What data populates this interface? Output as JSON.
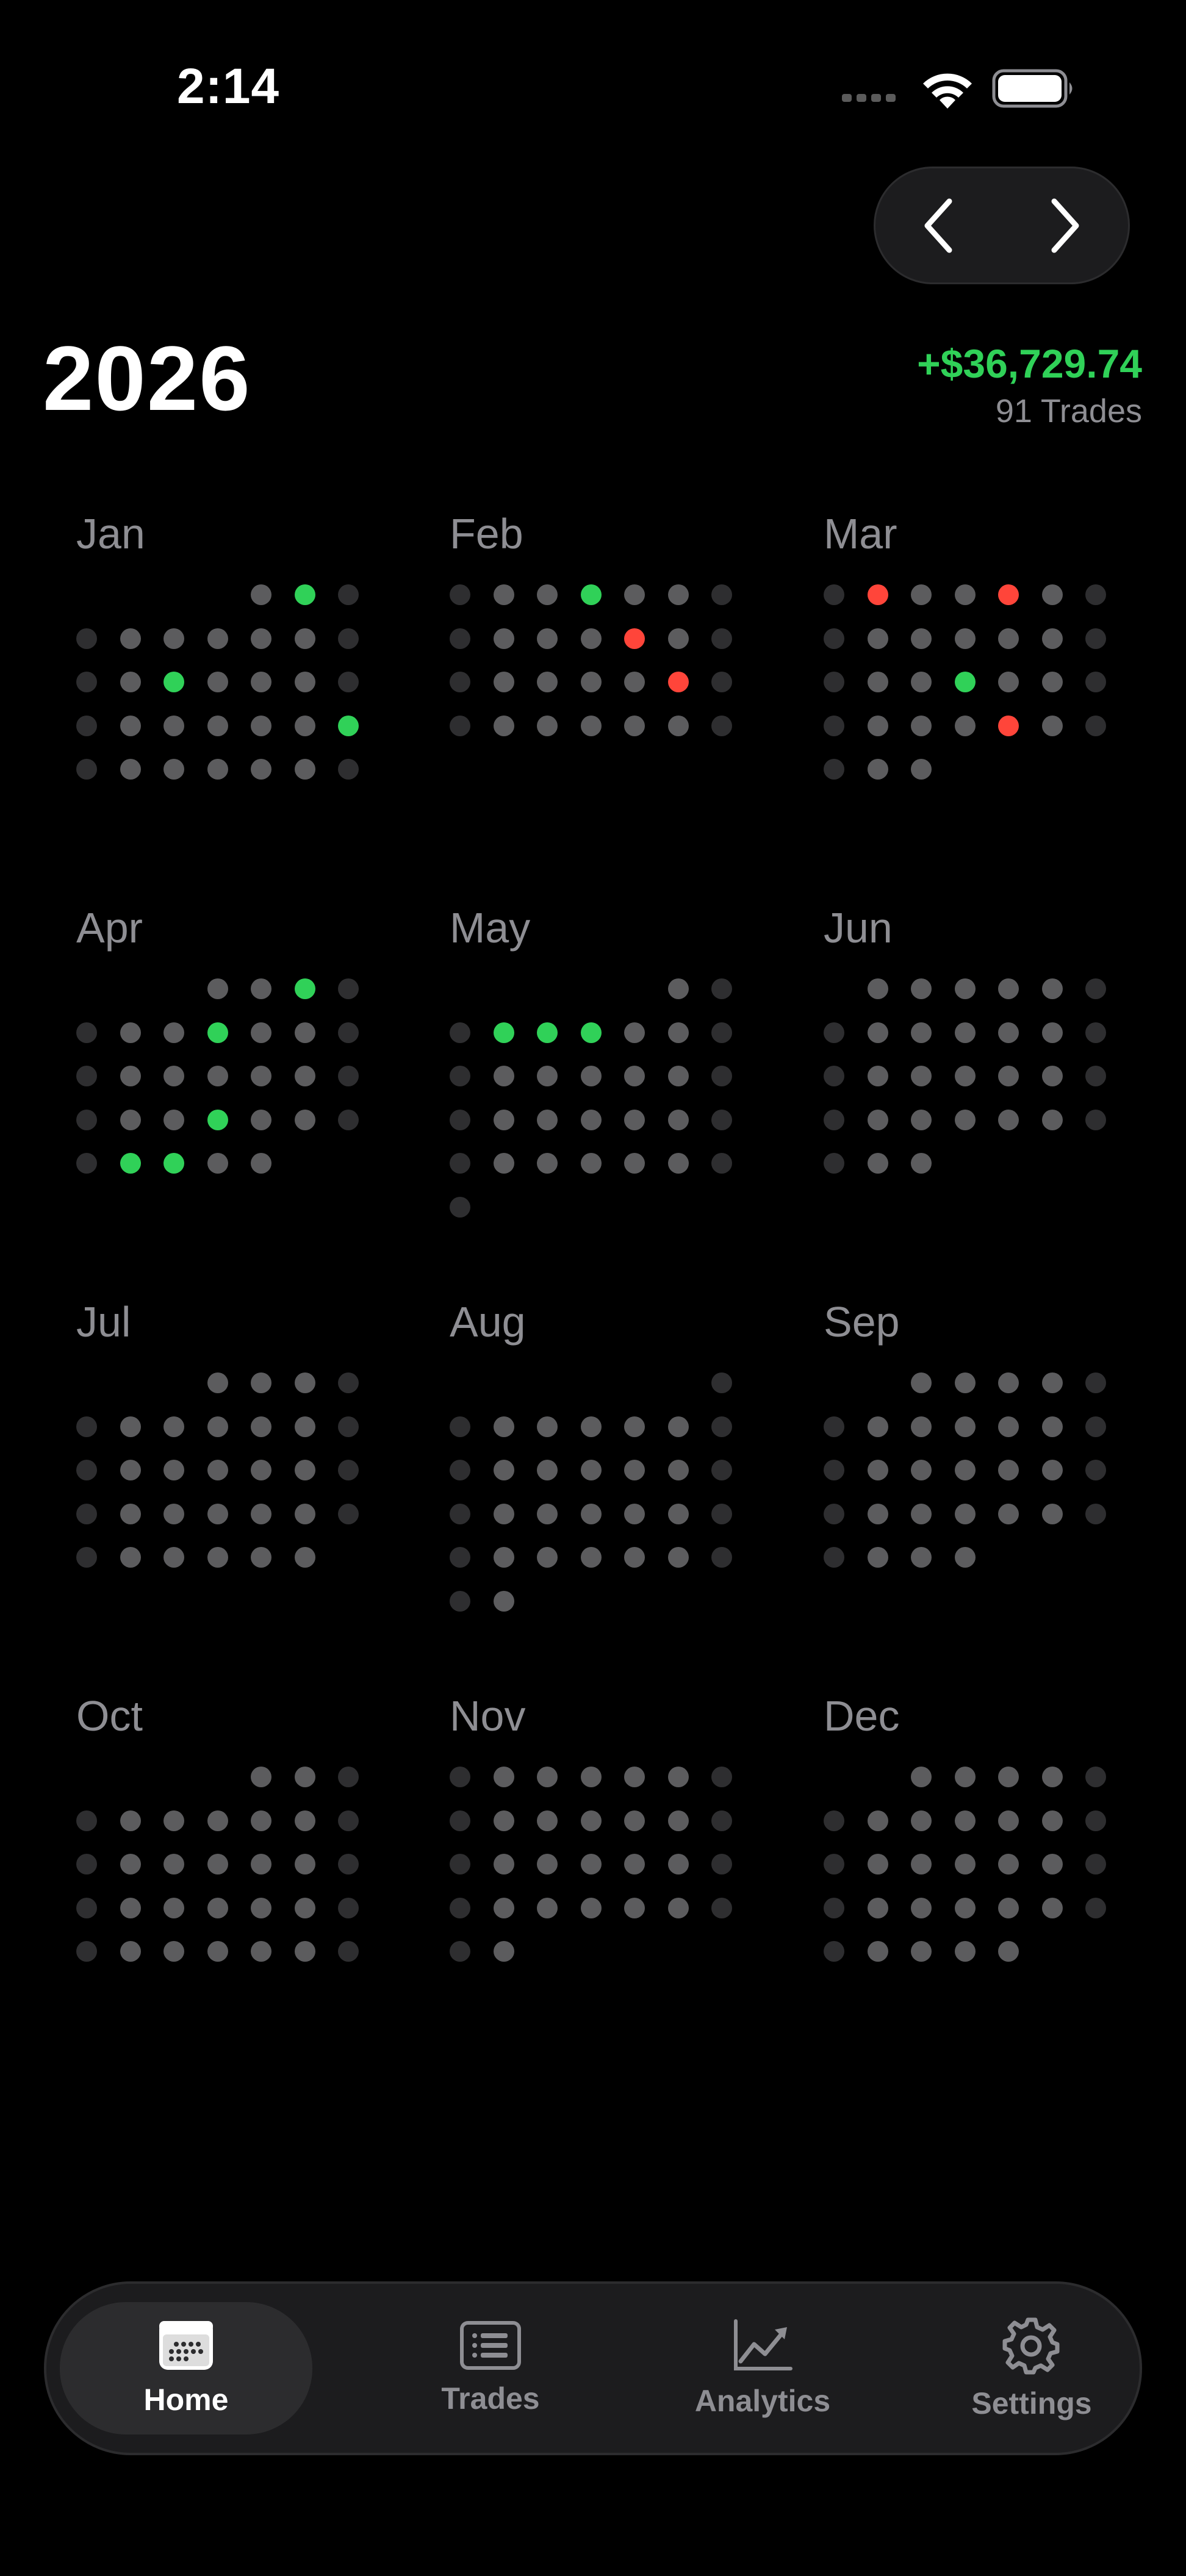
{
  "status_bar": {
    "time": "2:14",
    "icons": [
      "signal-dots-icon",
      "wifi-icon",
      "battery-icon"
    ]
  },
  "nav": {
    "prev_icon": "chevron-left-icon",
    "next_icon": "chevron-right-icon"
  },
  "header": {
    "year": "2026",
    "total_pnl": "+$36,729.74",
    "trade_count": "91 Trades"
  },
  "colors": {
    "background": "#000000",
    "win": "#30d158",
    "loss": "#ff453a",
    "trading_day": "#5c5c5e",
    "weekend_day": "#2e2e30",
    "muted_text": "#8e8e93"
  },
  "calendar": {
    "weekday_order": [
      "Sun",
      "Mon",
      "Tue",
      "Wed",
      "Thu",
      "Fri",
      "Sat"
    ],
    "months": [
      {
        "name": "Jan",
        "first_weekday": 4,
        "days": 31,
        "wins": [
          2,
          13,
          24
        ],
        "losses": []
      },
      {
        "name": "Feb",
        "first_weekday": 0,
        "days": 28,
        "wins": [
          4
        ],
        "losses": [
          12,
          20
        ]
      },
      {
        "name": "Mar",
        "first_weekday": 0,
        "days": 31,
        "wins": [
          18
        ],
        "losses": [
          2,
          5,
          26
        ]
      },
      {
        "name": "Apr",
        "first_weekday": 3,
        "days": 30,
        "wins": [
          3,
          8,
          22,
          27,
          28
        ],
        "losses": []
      },
      {
        "name": "May",
        "first_weekday": 5,
        "days": 31,
        "wins": [
          4,
          5,
          6
        ],
        "losses": []
      },
      {
        "name": "Jun",
        "first_weekday": 1,
        "days": 30,
        "wins": [],
        "losses": []
      },
      {
        "name": "Jul",
        "first_weekday": 3,
        "days": 31,
        "wins": [],
        "losses": []
      },
      {
        "name": "Aug",
        "first_weekday": 6,
        "days": 31,
        "wins": [],
        "losses": []
      },
      {
        "name": "Sep",
        "first_weekday": 2,
        "days": 30,
        "wins": [],
        "losses": []
      },
      {
        "name": "Oct",
        "first_weekday": 4,
        "days": 31,
        "wins": [],
        "losses": []
      },
      {
        "name": "Nov",
        "first_weekday": 0,
        "days": 30,
        "wins": [],
        "losses": []
      },
      {
        "name": "Dec",
        "first_weekday": 2,
        "days": 31,
        "wins": [],
        "losses": []
      }
    ]
  },
  "tabs": [
    {
      "label": "Home",
      "icon": "calendar-icon",
      "active": true
    },
    {
      "label": "Trades",
      "icon": "list-icon",
      "active": false
    },
    {
      "label": "Analytics",
      "icon": "chart-icon",
      "active": false
    },
    {
      "label": "Settings",
      "icon": "gear-icon",
      "active": false
    }
  ]
}
